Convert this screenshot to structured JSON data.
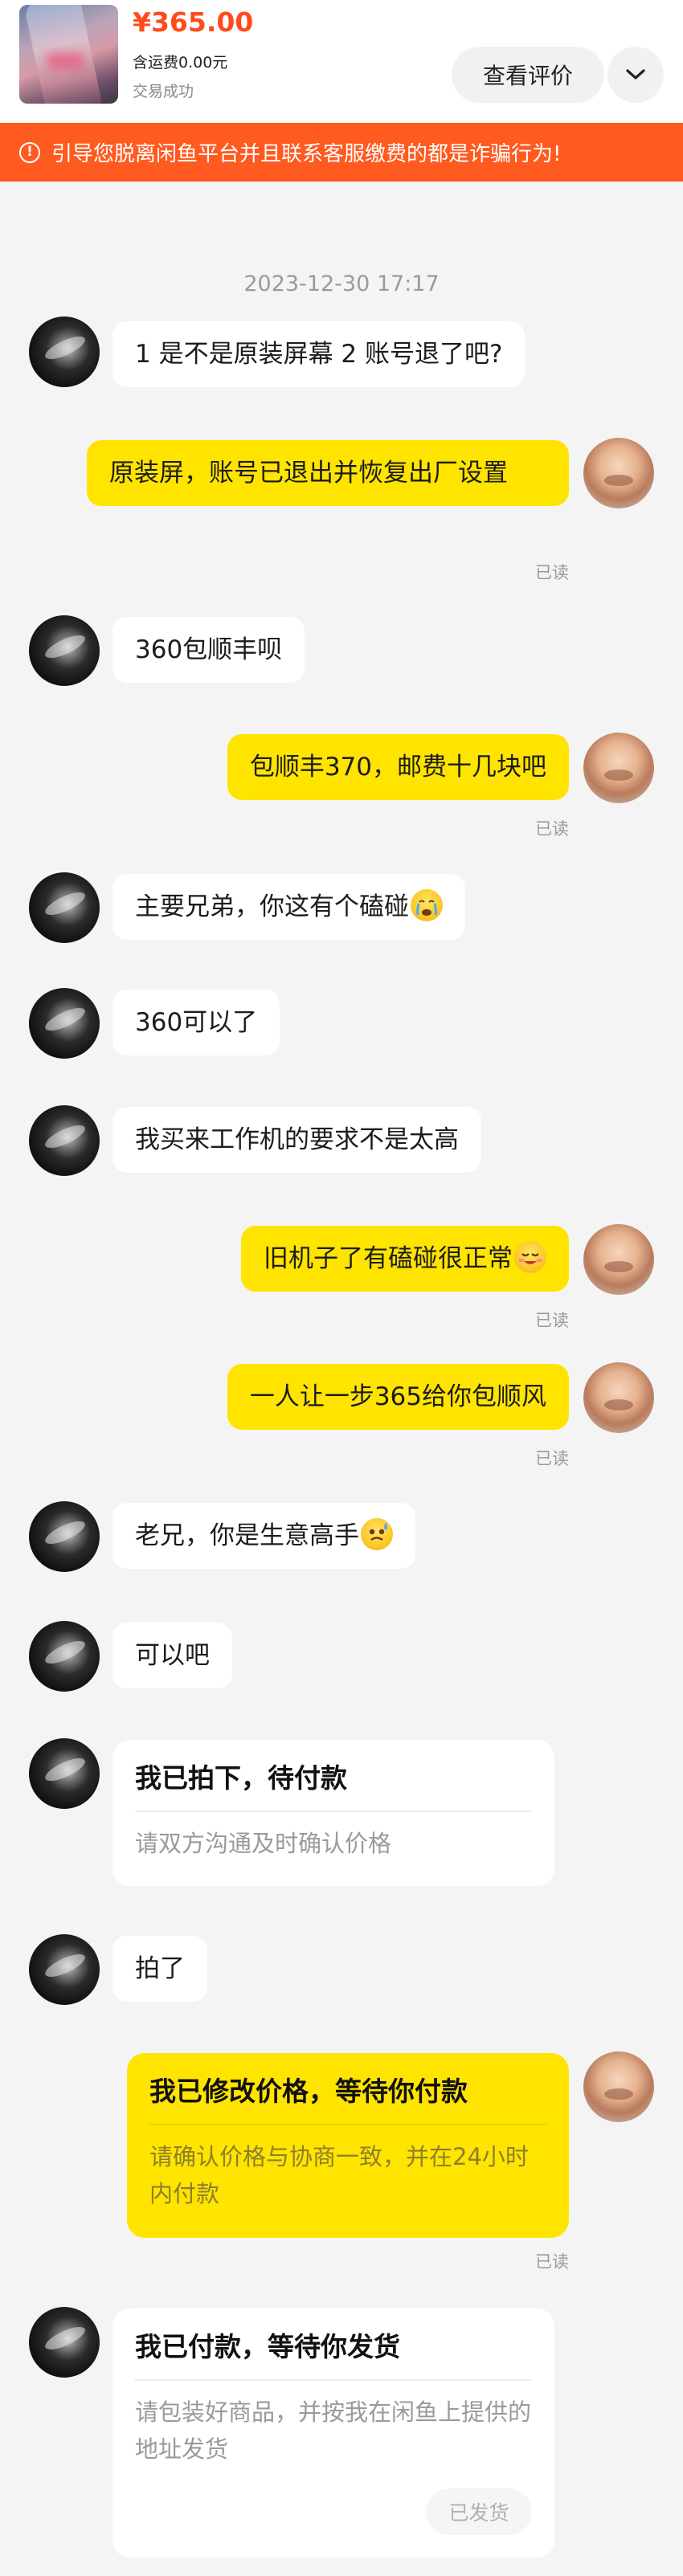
{
  "header": {
    "price": "¥365.00",
    "shipping": "含运费0.00元",
    "trade_status": "交易成功",
    "review_button": "查看评价",
    "expand_icon": "chevron-down-icon"
  },
  "warning": {
    "icon": "alert-circle-icon",
    "text": "引导您脱离闲鱼平台并且联系客服缴费的都是诈骗行为!"
  },
  "chat": {
    "timestamp": "2023-12-30 17:17",
    "read_label": "已读",
    "messages": [
      {
        "from": "other",
        "text": "1 是不是原装屏幕   2 账号退了吧?"
      },
      {
        "from": "self",
        "text": "原装屏，账号已退出并恢复出厂设置"
      },
      {
        "from": "other",
        "text": "360包顺丰呗"
      },
      {
        "from": "self",
        "text": "包顺丰370，邮费十几块吧"
      },
      {
        "from": "other",
        "text": "主要兄弟，你这有个磕碰",
        "emoji": "crying-face-icon"
      },
      {
        "from": "other",
        "text": "360可以了"
      },
      {
        "from": "other",
        "text": "我买来工作机的要求不是太高"
      },
      {
        "from": "self",
        "text": "旧机子了有磕碰很正常",
        "emoji": "smirk-face-icon"
      },
      {
        "from": "self",
        "text": "一人让一步365给你包顺风"
      },
      {
        "from": "other",
        "text": "老兄，你是生意高手",
        "emoji": "sweat-smile-face-icon"
      },
      {
        "from": "other",
        "text": "可以吧"
      },
      {
        "from": "other",
        "text": "拍了"
      }
    ],
    "cards": [
      {
        "from": "other",
        "title": "我已拍下，待付款",
        "body": "请双方沟通及时确认价格"
      },
      {
        "from": "self",
        "title": "我已修改价格，等待你付款",
        "body": "请确认价格与协商一致，并在24小时内付款"
      },
      {
        "from": "other",
        "title": "我已付款，等待你发货",
        "body": "请包装好商品，并按我在闲鱼上提供的地址发货",
        "button": "已发货"
      }
    ]
  },
  "colors": {
    "accent_orange": "#ff5a1f",
    "price_red": "#ff4a1c",
    "self_bubble_yellow": "#ffe400",
    "background": "#f4f4f5"
  }
}
